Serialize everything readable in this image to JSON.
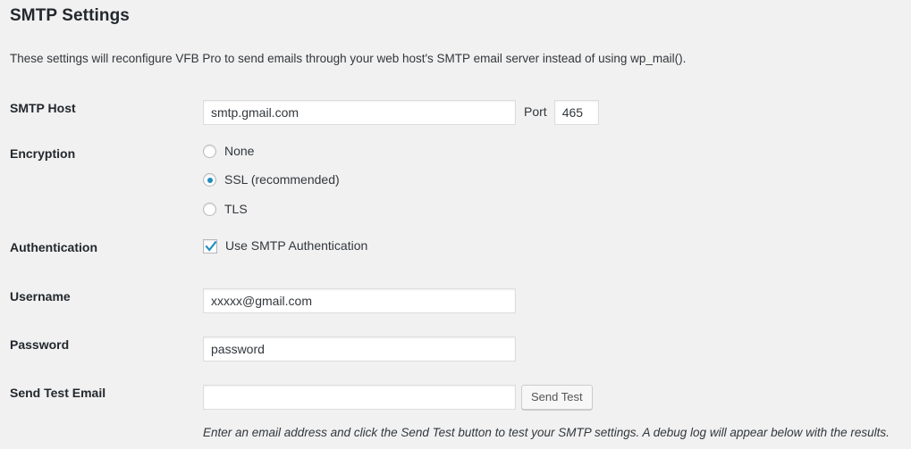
{
  "header": {
    "title": "SMTP Settings",
    "description": "These settings will reconfigure VFB Pro to send emails through your web host's SMTP email server instead of using wp_mail()."
  },
  "fields": {
    "host": {
      "label": "SMTP Host",
      "value": "smtp.gmail.com",
      "placeholder": ""
    },
    "port": {
      "label": "Port",
      "value": "465",
      "placeholder": ""
    },
    "encryption": {
      "label": "Encryption",
      "options": [
        {
          "label": "None",
          "checked": false
        },
        {
          "label": "SSL (recommended)",
          "checked": true
        },
        {
          "label": "TLS",
          "checked": false
        }
      ]
    },
    "authentication": {
      "label": "Authentication",
      "checkbox_label": "Use SMTP Authentication",
      "checked": true
    },
    "username": {
      "label": "Username",
      "value": "xxxxx@gmail.com",
      "placeholder": ""
    },
    "password": {
      "label": "Password",
      "value": "password",
      "placeholder": ""
    },
    "send_test_email": {
      "label": "Send Test Email",
      "value": "",
      "placeholder": "",
      "button_label": "Send Test",
      "help_text": "Enter an email address and click the Send Test button to test your SMTP settings. A debug log will appear below with the results."
    }
  },
  "colors": {
    "background": "#f1f1f1",
    "accent": "#1e8cbe",
    "text": "#32373c",
    "heading": "#23282d",
    "input_border": "#ddd"
  }
}
